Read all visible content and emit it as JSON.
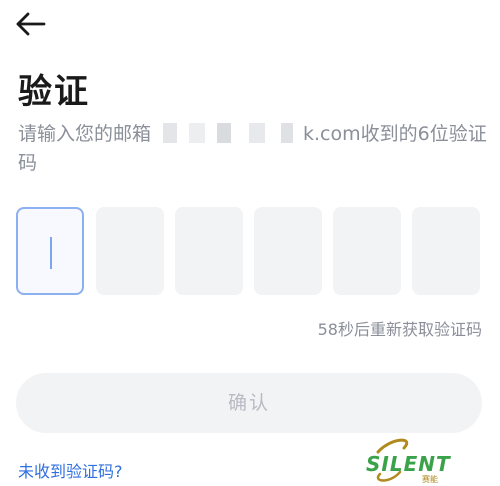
{
  "header": {
    "back_icon": "arrow-left-icon"
  },
  "page": {
    "title": "验证",
    "desc_prefix": "请输入您的邮箱",
    "desc_suffix": "k.com收到的6位验证码"
  },
  "code_input": {
    "box_count": 6,
    "values": [
      "",
      "",
      "",
      "",
      "",
      ""
    ],
    "active_index": 0
  },
  "resend": {
    "text": "58秒后重新获取验证码"
  },
  "confirm": {
    "label": "确认"
  },
  "help": {
    "no_code_link": "未收到验证码?"
  },
  "watermark": {
    "text": "SILENT",
    "sub": "赛能"
  },
  "colors": {
    "accent": "#2f6fe0",
    "active_border": "#8db0f0",
    "box_bg": "#f2f3f5",
    "muted_text": "#8a8f99",
    "watermark_green": "#3aa34a"
  }
}
